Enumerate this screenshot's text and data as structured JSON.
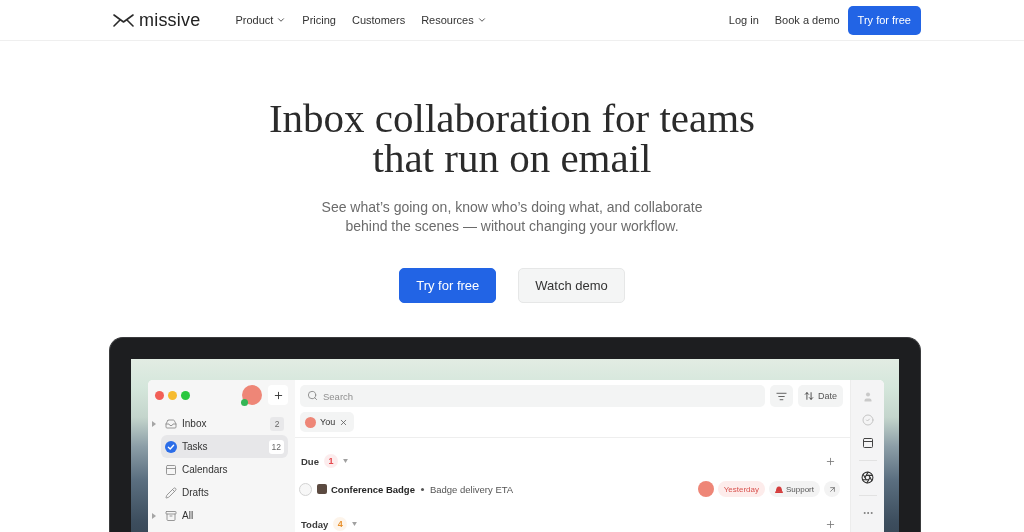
{
  "nav": {
    "logo": "missive",
    "links": [
      {
        "label": "Product",
        "dropdown": true
      },
      {
        "label": "Pricing",
        "dropdown": false
      },
      {
        "label": "Customers",
        "dropdown": false
      },
      {
        "label": "Resources",
        "dropdown": true
      }
    ],
    "actions": [
      {
        "label": "Log in",
        "kind": "link"
      },
      {
        "label": "Book a demo",
        "kind": "link"
      },
      {
        "label": "Try for free",
        "kind": "primary"
      }
    ]
  },
  "hero": {
    "title_lines": [
      "Inbox collaboration for teams",
      "that run on email"
    ],
    "subtitle_lines": [
      "See what’s going on, know who’s doing what, and collaborate",
      "behind the scenes — without changing your workflow."
    ],
    "buttons": [
      {
        "label": "Try for free",
        "kind": "primary"
      },
      {
        "label": "Watch demo",
        "kind": "secondary"
      }
    ]
  },
  "app": {
    "account": {
      "online": true
    },
    "sidebar": {
      "items": [
        {
          "label": "Inbox",
          "kind": "inbox",
          "count": "2",
          "expandable": true,
          "selected": false
        },
        {
          "label": "Tasks",
          "kind": "tasks",
          "count": "12",
          "expandable": false,
          "selected": true
        },
        {
          "label": "Calendars",
          "kind": "calendars",
          "expandable": false,
          "selected": false
        },
        {
          "label": "Drafts",
          "kind": "drafts",
          "expandable": false,
          "selected": false
        },
        {
          "label": "All",
          "kind": "all",
          "expandable": true,
          "selected": false
        }
      ]
    },
    "search": {
      "placeholder": "Search"
    },
    "sort": {
      "label": "Date"
    },
    "filter_chips": [
      {
        "label": "You"
      }
    ],
    "groups": [
      {
        "title": "Due",
        "count": "1",
        "color": "#e5484d",
        "tasks": [
          {
            "title": "Conference Badge",
            "subtitle": "Badge delivery ETA",
            "checked": false,
            "due": "Yesterday",
            "overdue": true,
            "tag": "Support"
          }
        ]
      },
      {
        "title": "Today",
        "count": "4",
        "color": "#e8912d"
      }
    ]
  }
}
